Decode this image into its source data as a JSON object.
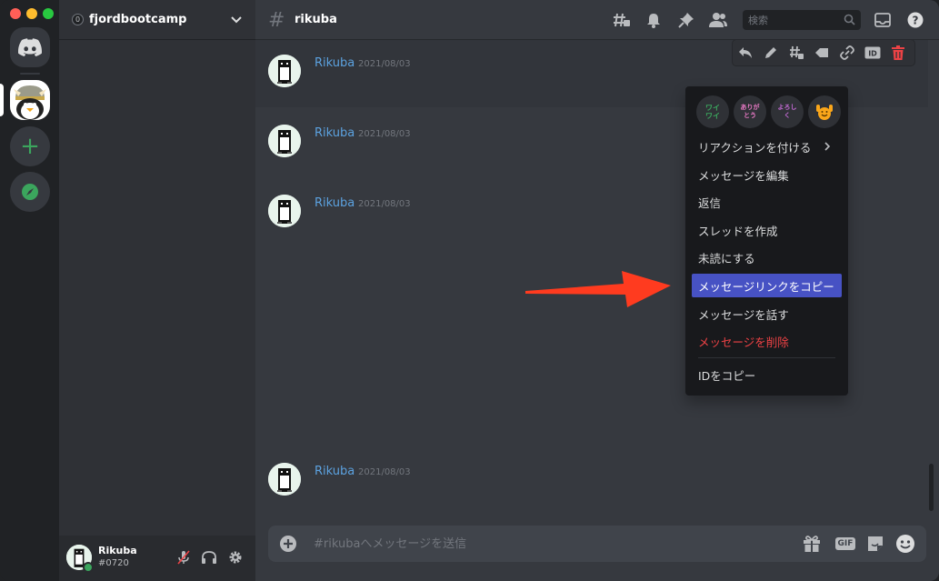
{
  "server": {
    "name": "fjordbootcamp",
    "badge": "0"
  },
  "channel": {
    "name": "rikuba"
  },
  "search": {
    "placeholder": "検索"
  },
  "user": {
    "name": "Rikuba",
    "tag": "#0720"
  },
  "messages": [
    {
      "author": "Rikuba",
      "time": "2021/08/03"
    },
    {
      "author": "Rikuba",
      "time": "2021/08/03"
    },
    {
      "author": "Rikuba",
      "time": "2021/08/03"
    },
    {
      "author": "Rikuba",
      "time": "2021/08/03"
    }
  ],
  "composer": {
    "placeholder": "#rikubaへメッセージを送信",
    "gif_label": "GIF"
  },
  "context_menu": {
    "reactions": [
      {
        "label": "ワイ\nワイ",
        "icon": "waiwai-emoji",
        "color": "#3ba55d"
      },
      {
        "label": "ありが\nとう",
        "icon": "arigatou-emoji",
        "color": "#e879c5"
      },
      {
        "label": "よろし\nく",
        "icon": "yoroshiku-emoji",
        "color": "#c56bd6"
      },
      {
        "label": "",
        "icon": "hands-up-emoji",
        "color": "#faa61a"
      }
    ],
    "items": [
      {
        "label": "リアクションを付ける",
        "state": "normal",
        "has_submenu": true
      },
      {
        "label": "メッセージを編集",
        "state": "normal"
      },
      {
        "label": "返信",
        "state": "normal"
      },
      {
        "label": "スレッドを作成",
        "state": "normal"
      },
      {
        "label": "未読にする",
        "state": "normal"
      },
      {
        "label": "メッセージリンクをコピー",
        "state": "highlighted"
      },
      {
        "label": "メッセージを話す",
        "state": "normal"
      },
      {
        "label": "メッセージを削除",
        "state": "danger"
      },
      {
        "label": "IDをコピー",
        "state": "normal"
      }
    ]
  },
  "colors": {
    "accent": "#4752c4",
    "danger": "#ed4245",
    "online": "#3ba55d",
    "link_name": "#5ca2e0",
    "annotation_arrow": "#ff3b1f"
  }
}
